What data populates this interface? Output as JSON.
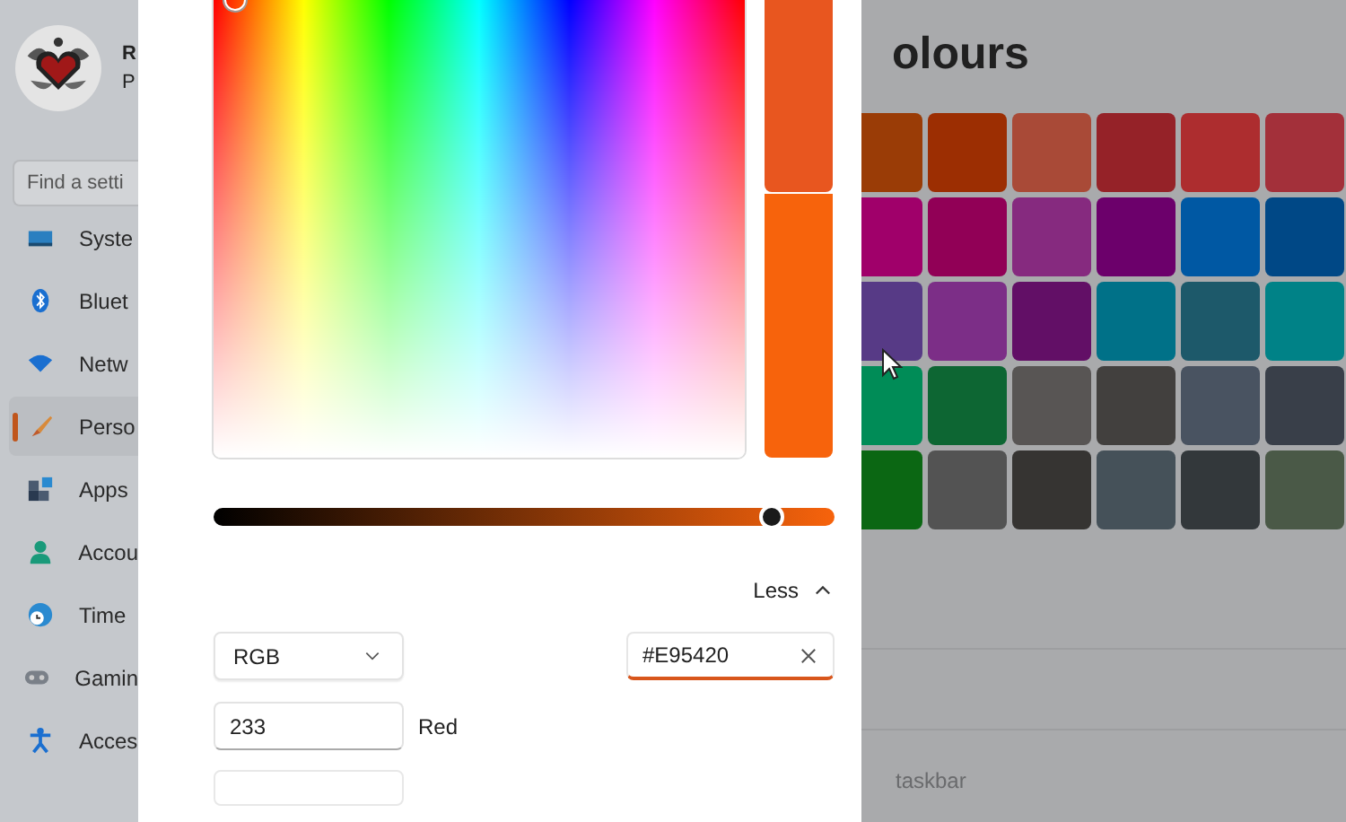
{
  "sidebar": {
    "user_name": "R",
    "user_subtitle": "P",
    "search": {
      "placeholder": "Find a setti"
    },
    "items": [
      {
        "label": "Syste",
        "selected": false
      },
      {
        "label": "Bluet",
        "selected": false
      },
      {
        "label": "Netw",
        "selected": false
      },
      {
        "label": "Perso",
        "selected": true
      },
      {
        "label": "Apps",
        "selected": false
      },
      {
        "label": "Accou",
        "selected": false
      },
      {
        "label": "Time",
        "selected": false
      },
      {
        "label": "Gamin",
        "selected": false
      },
      {
        "label": "Acces",
        "selected": false
      }
    ]
  },
  "page": {
    "heading": "olours",
    "swatches": [
      {
        "color": "#9a3c06"
      },
      {
        "color": "#9c2e02"
      },
      {
        "color": "#a94a37"
      },
      {
        "color": "#952228"
      },
      {
        "color": "#ad2d2f"
      },
      {
        "color": "#a3303a"
      },
      {
        "color": "#a0006a"
      },
      {
        "color": "#910056"
      },
      {
        "color": "#862a7f"
      },
      {
        "color": "#6c006b"
      },
      {
        "color": "#0058a3"
      },
      {
        "color": "#004886"
      },
      {
        "color": "#573a86"
      },
      {
        "color": "#7c2e87"
      },
      {
        "color": "#620f66"
      },
      {
        "color": "#007188"
      },
      {
        "color": "#1d596a"
      },
      {
        "color": "#008287"
      },
      {
        "color": "#008c57"
      },
      {
        "color": "#0d6633"
      },
      {
        "color": "#585554"
      },
      {
        "color": "#42403e"
      },
      {
        "color": "#495361"
      },
      {
        "color": "#393f49"
      },
      {
        "color": "#0b6713"
      },
      {
        "color": "#535353"
      },
      {
        "color": "#363432"
      },
      {
        "color": "#455159"
      },
      {
        "color": "#33383b"
      },
      {
        "color": "#4a5947"
      }
    ],
    "footer_text": "taskbar"
  },
  "dialog": {
    "value_slider": {
      "level": 0.9
    },
    "toggle": "Less",
    "mode_dropdown": "RGB",
    "hex_field": {
      "value": "#E95420"
    },
    "channels": [
      {
        "value": "233",
        "label": "Red"
      }
    ]
  }
}
